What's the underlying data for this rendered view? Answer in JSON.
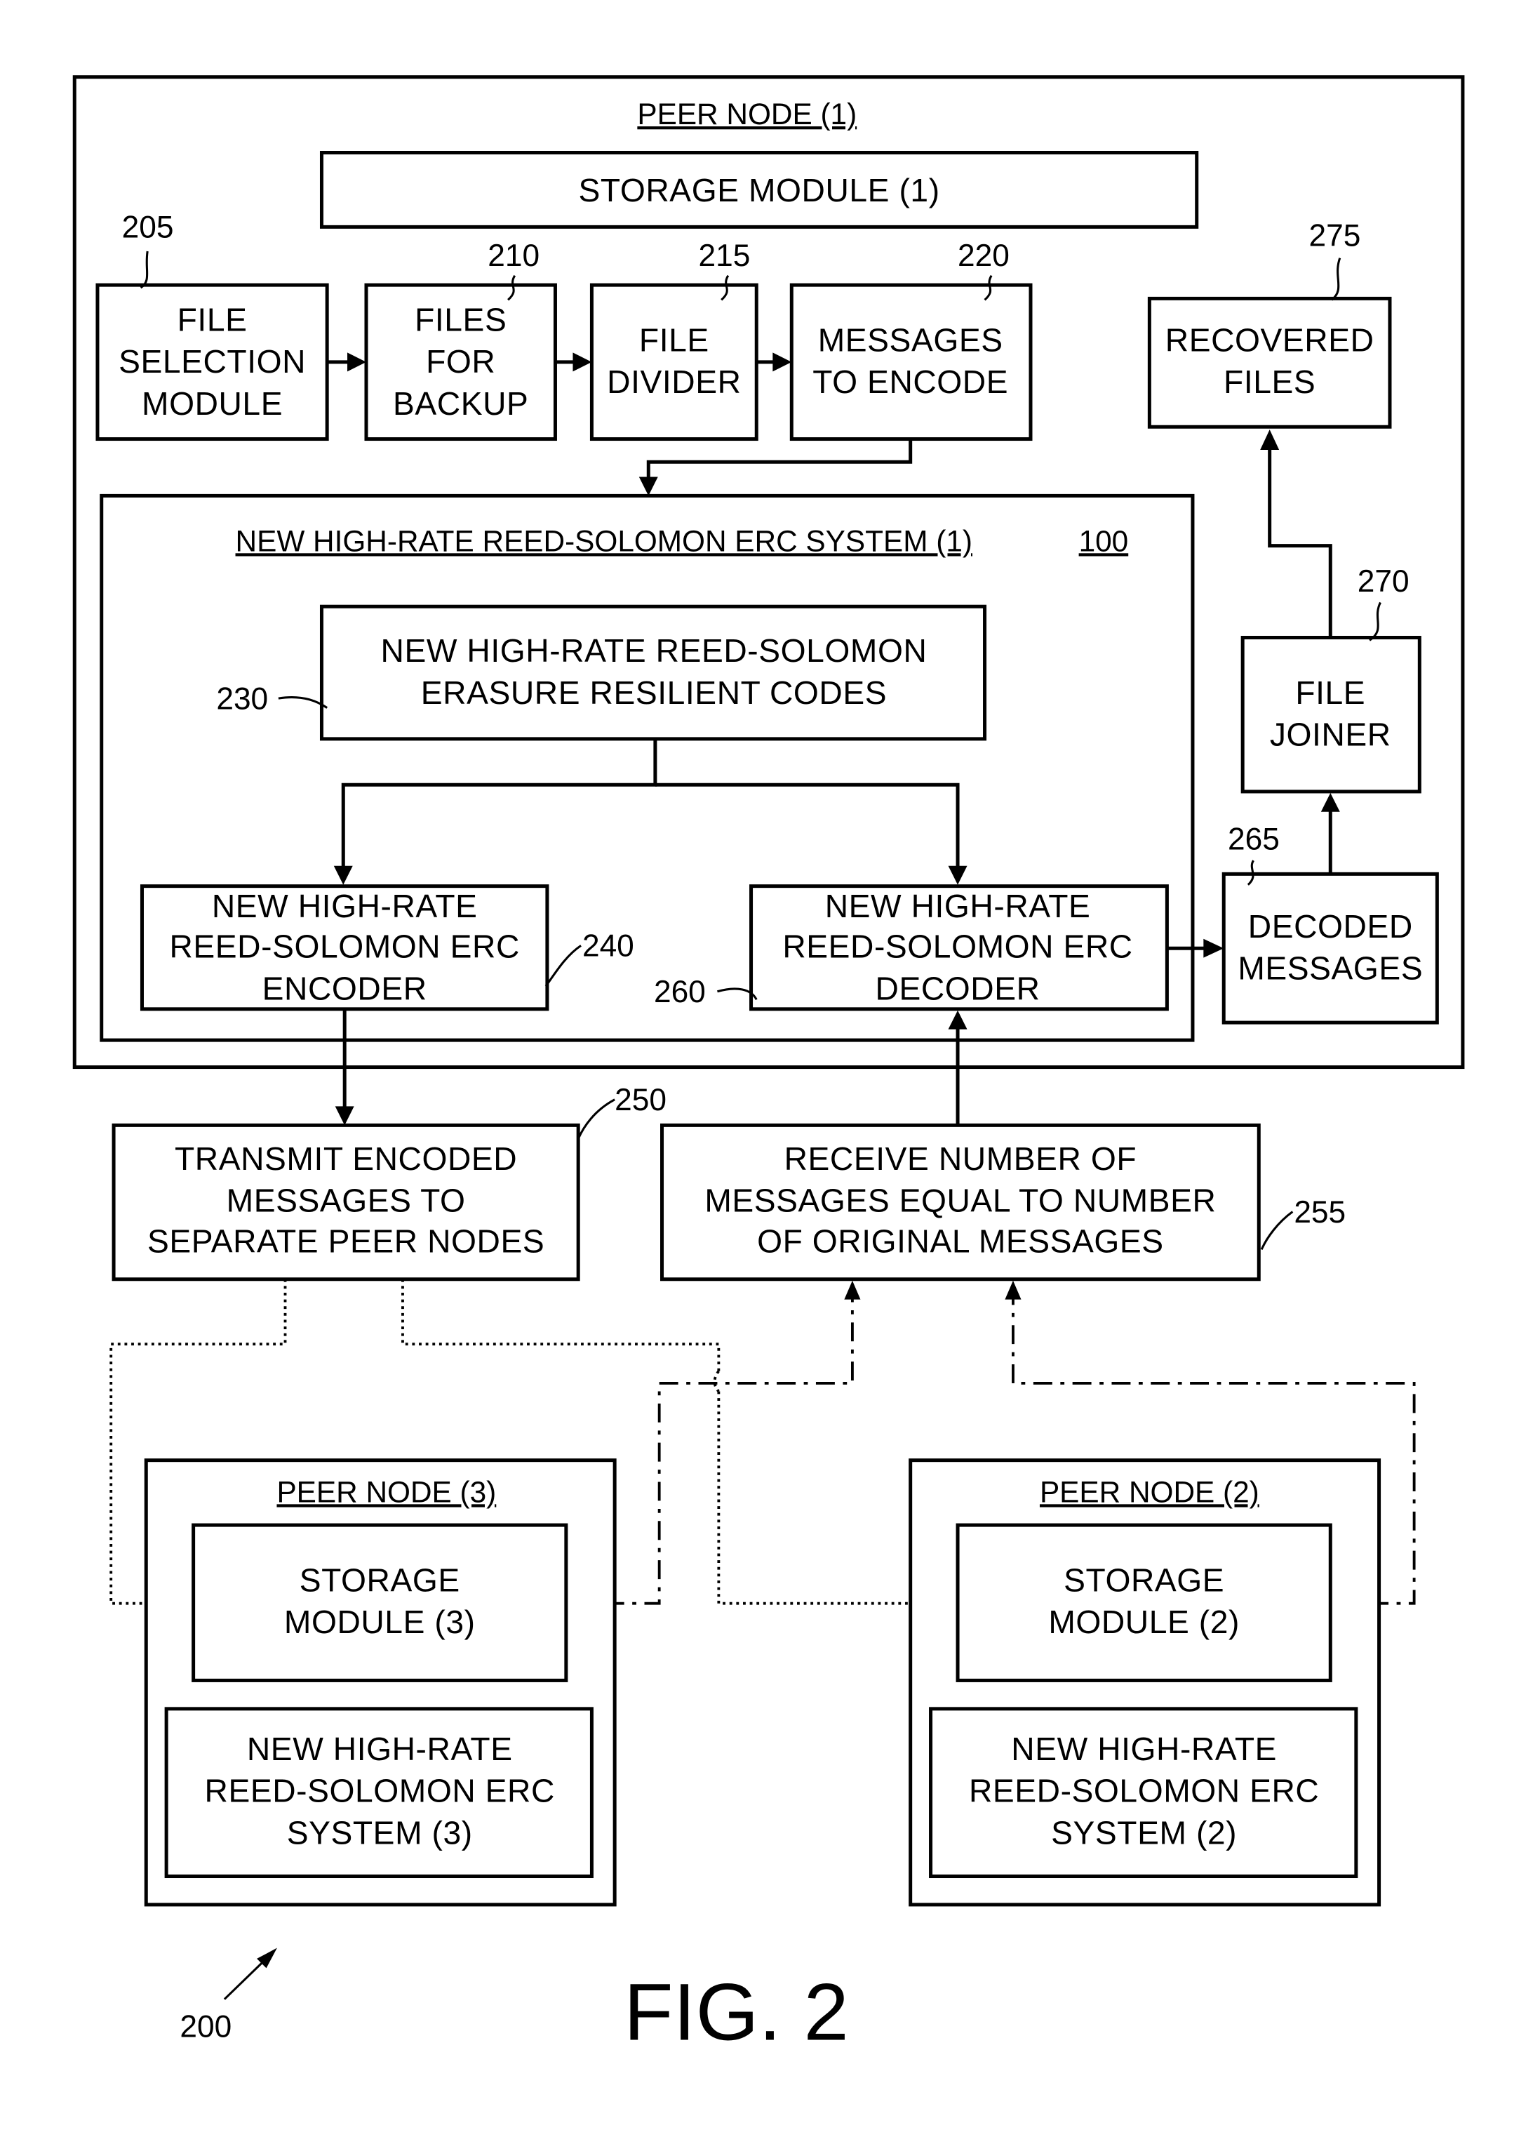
{
  "figure": {
    "label": "FIG. 2",
    "reference": "200"
  },
  "peer_node_1": {
    "title": "PEER NODE (1)",
    "storage_module": "STORAGE MODULE (1)",
    "file_selection": {
      "ref": "205",
      "lines": [
        "FILE",
        "SELECTION",
        "MODULE"
      ]
    },
    "files_for_backup": {
      "ref": "210",
      "lines": [
        "FILES",
        "FOR",
        "BACKUP"
      ]
    },
    "file_divider": {
      "ref": "215",
      "lines": [
        "FILE",
        "DIVIDER"
      ]
    },
    "messages_to_encode": {
      "ref": "220",
      "lines": [
        "MESSAGES",
        "TO ENCODE"
      ]
    },
    "recovered_files": {
      "ref": "275",
      "lines": [
        "RECOVERED",
        "FILES"
      ]
    },
    "file_joiner": {
      "ref": "270",
      "lines": [
        "FILE",
        "JOINER"
      ]
    },
    "decoded_messages": {
      "ref": "265",
      "lines": [
        "DECODED",
        "MESSAGES"
      ]
    },
    "erc_system": {
      "title": "NEW HIGH-RATE REED-SOLOMON ERC SYSTEM (1)",
      "ref": "100",
      "codes": {
        "ref": "230",
        "lines": [
          "NEW HIGH-RATE REED-SOLOMON",
          "ERASURE RESILIENT CODES"
        ]
      },
      "encoder": {
        "ref": "240",
        "lines": [
          "NEW HIGH-RATE",
          "REED-SOLOMON ERC",
          "ENCODER"
        ]
      },
      "decoder": {
        "ref": "260",
        "lines": [
          "NEW HIGH-RATE",
          "REED-SOLOMON ERC",
          "DECODER"
        ]
      }
    }
  },
  "transmit": {
    "ref": "250",
    "lines": [
      "TRANSMIT ENCODED",
      "MESSAGES TO",
      "SEPARATE PEER NODES"
    ]
  },
  "receive": {
    "ref": "255",
    "lines": [
      "RECEIVE NUMBER OF",
      "MESSAGES EQUAL TO NUMBER",
      "OF ORIGINAL MESSAGES"
    ]
  },
  "peer_node_3": {
    "title": "PEER NODE (3)",
    "storage_lines": [
      "STORAGE",
      "MODULE (3)"
    ],
    "system_lines": [
      "NEW HIGH-RATE",
      "REED-SOLOMON ERC",
      "SYSTEM (3)"
    ]
  },
  "peer_node_2": {
    "title": "PEER NODE (2)",
    "storage_lines": [
      "STORAGE",
      "MODULE (2)"
    ],
    "system_lines": [
      "NEW HIGH-RATE",
      "REED-SOLOMON ERC",
      "SYSTEM (2)"
    ]
  }
}
